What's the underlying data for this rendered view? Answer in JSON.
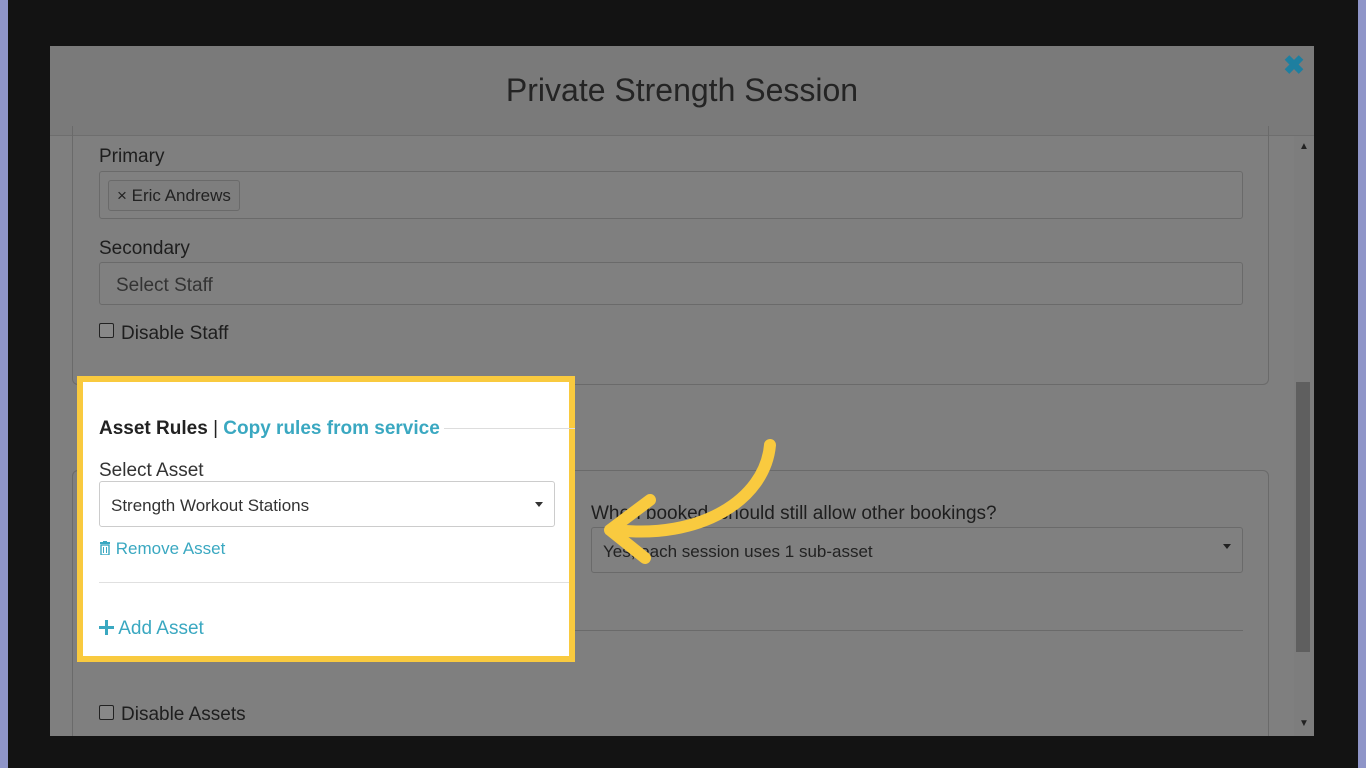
{
  "modal": {
    "title": "Private Strength Session"
  },
  "staff": {
    "primary_label": "Primary",
    "primary_tags": [
      "× Eric Andrews"
    ],
    "secondary_label": "Secondary",
    "secondary_placeholder": "Select Staff",
    "disable_label": "Disable Staff"
  },
  "assets": {
    "legend_title": "Asset Rules",
    "legend_separator": "|",
    "copy_link": "Copy rules from service",
    "select_label": "Select Asset",
    "selected_asset": "Strength Workout Stations",
    "remove_label": "Remove Asset",
    "booking_question": "When booked, should still allow other bookings?",
    "booking_option": "Yes, each session uses 1 sub-asset",
    "add_label": "Add Asset",
    "disable_label": "Disable Assets"
  },
  "colors": {
    "highlight": "#f9ca3f",
    "link": "#3aa8c1",
    "arrow": "#f9ca3f"
  },
  "icons": {
    "close": "close-icon",
    "trash": "trash-icon",
    "plus": "plus-icon",
    "caret": "caret-down-icon"
  }
}
